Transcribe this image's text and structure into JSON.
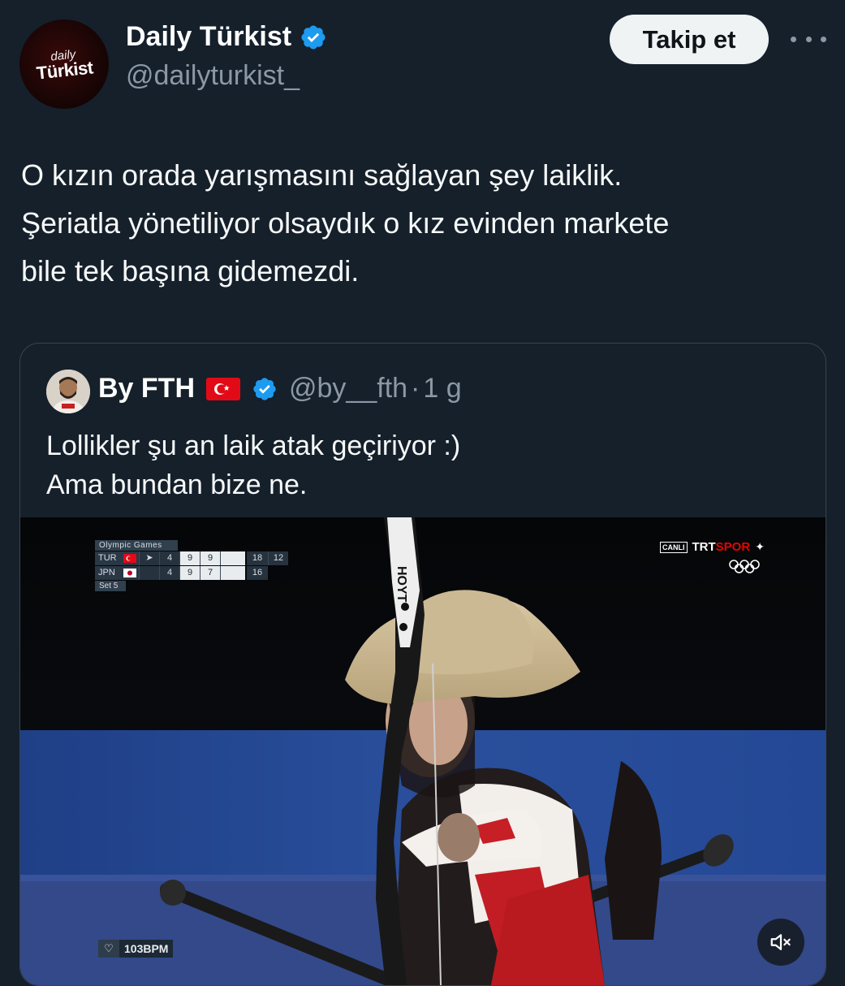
{
  "author": {
    "avatar_text_top": "daily",
    "avatar_text_bottom": "Türkist",
    "name": "Daily Türkist",
    "handle": "@dailyturkist_",
    "verified_icon": "verified-badge-icon"
  },
  "header_actions": {
    "follow_label": "Takip et",
    "more_icon": "more-options-icon"
  },
  "tweet": {
    "lines": [
      "O kızın orada yarışmasını sağlayan şey laiklik.",
      "Şeriatla yönetiliyor olsaydık o kız evinden markete",
      "bile tek başına gidemezdi."
    ]
  },
  "quoted_tweet": {
    "name": "By FTH",
    "handle": "@by__fth",
    "separator": "·",
    "time": "1 g",
    "flag_icon": "turkey-flag-icon",
    "text_lines": [
      "Lollikler şu an laik atak geçiriyor :)",
      "Ama bundan bize ne."
    ],
    "media": {
      "scoreboard": {
        "title": "Olympic Games",
        "rows": [
          {
            "team": "TUR",
            "sets": "4",
            "s1": "9",
            "s2": "9",
            "total": "18",
            "extra": "12"
          },
          {
            "team": "JPN",
            "sets": "4",
            "s1": "9",
            "s2": "7",
            "total": "16",
            "extra": ""
          }
        ],
        "set_label": "Set 5"
      },
      "broadcaster": {
        "canli": "CANLI",
        "trt": "TRT",
        "spor": "SPOR"
      },
      "heart_rate": "103BPM",
      "mute_icon": "volume-muted-icon"
    }
  },
  "colors": {
    "background": "#15202b",
    "secondary_text": "#8b98a5",
    "verified_blue": "#1d9bf0",
    "border": "#38444d"
  }
}
